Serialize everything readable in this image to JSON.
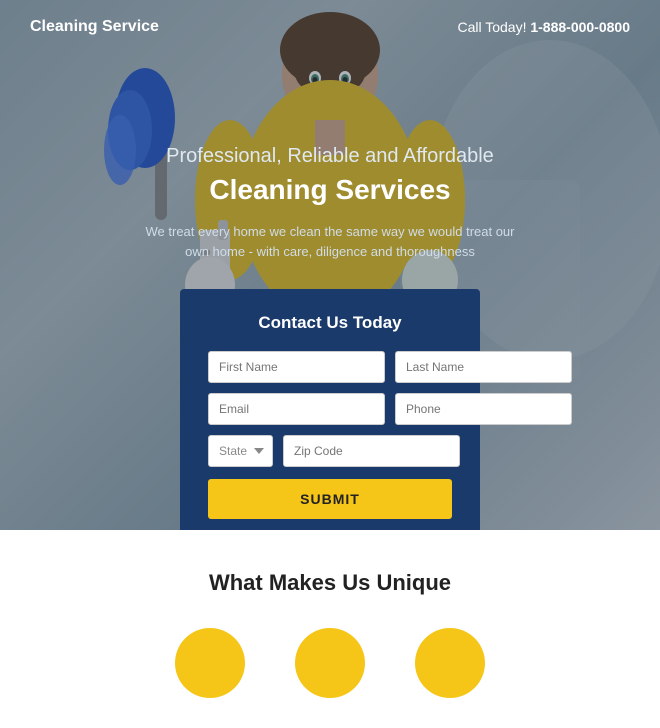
{
  "header": {
    "logo": "Cleaning Service",
    "phone_label": "Call Today!",
    "phone_number": "1-888-000-0800"
  },
  "hero": {
    "subtitle": "Professional, Reliable and Affordable",
    "title": "Cleaning Services",
    "description": "We treat every home we clean the same way we would treat our own home - with care, diligence and thoroughness"
  },
  "contact_form": {
    "title": "Contact Us Today",
    "first_name_placeholder": "First Name",
    "last_name_placeholder": "Last Name",
    "email_placeholder": "Email",
    "phone_placeholder": "Phone",
    "state_placeholder": "State",
    "zip_placeholder": "Zip Code",
    "submit_label": "SUBMIT"
  },
  "lower": {
    "title": "What Makes Us Unique",
    "features": [
      {
        "id": "feature-1"
      },
      {
        "id": "feature-2"
      },
      {
        "id": "feature-3"
      }
    ]
  }
}
